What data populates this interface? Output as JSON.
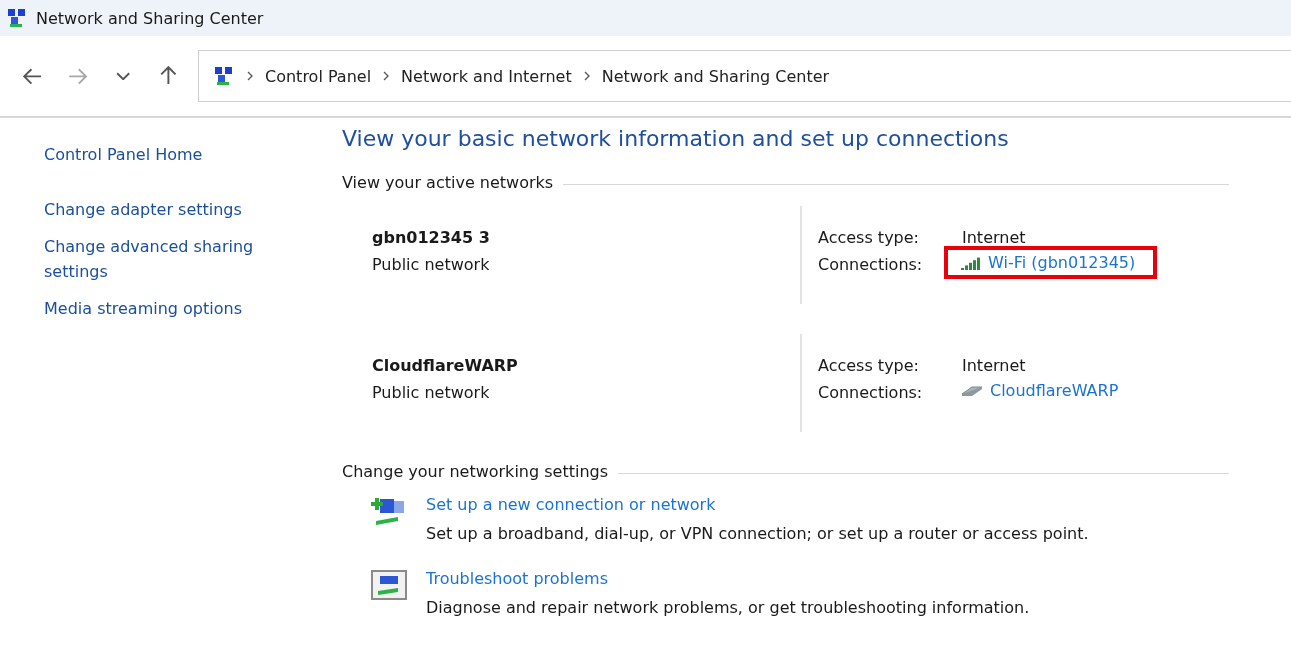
{
  "window": {
    "title": "Network and Sharing Center"
  },
  "nav_buttons": [
    {
      "kind": "back",
      "disabled": false
    },
    {
      "kind": "forward",
      "disabled": true
    },
    {
      "kind": "recent",
      "disabled": false
    },
    {
      "kind": "up",
      "disabled": false
    }
  ],
  "breadcrumb": [
    "Control Panel",
    "Network and Internet",
    "Network and Sharing Center"
  ],
  "sidebar": {
    "items": [
      "Control Panel Home",
      "Change adapter settings",
      "Change advanced sharing settings",
      "Media streaming options"
    ]
  },
  "heading": "View your basic network information and set up connections",
  "active_networks": {
    "title": "View your active networks",
    "networks": [
      {
        "name": "gbn012345 3",
        "category": "Public network",
        "access_label": "Access type:",
        "access_value": "Internet",
        "connections_label": "Connections:",
        "connection": {
          "kind": "wifi",
          "label": "Wi-Fi (gbn012345)",
          "highlighted": true
        }
      },
      {
        "name": "CloudflareWARP",
        "category": "Public network",
        "access_label": "Access type:",
        "access_value": "Internet",
        "connections_label": "Connections:",
        "connection": {
          "kind": "ethernet",
          "label": "CloudflareWARP",
          "highlighted": false
        }
      }
    ]
  },
  "settings": {
    "title": "Change your networking settings",
    "tasks": [
      {
        "kind": "new-connection",
        "link": "Set up a new connection or network",
        "description": "Set up a broadband, dial-up, or VPN connection; or set up a router or access point."
      },
      {
        "kind": "troubleshoot",
        "link": "Troubleshoot problems",
        "description": "Diagnose and repair network problems, or get troubleshooting information."
      }
    ]
  }
}
